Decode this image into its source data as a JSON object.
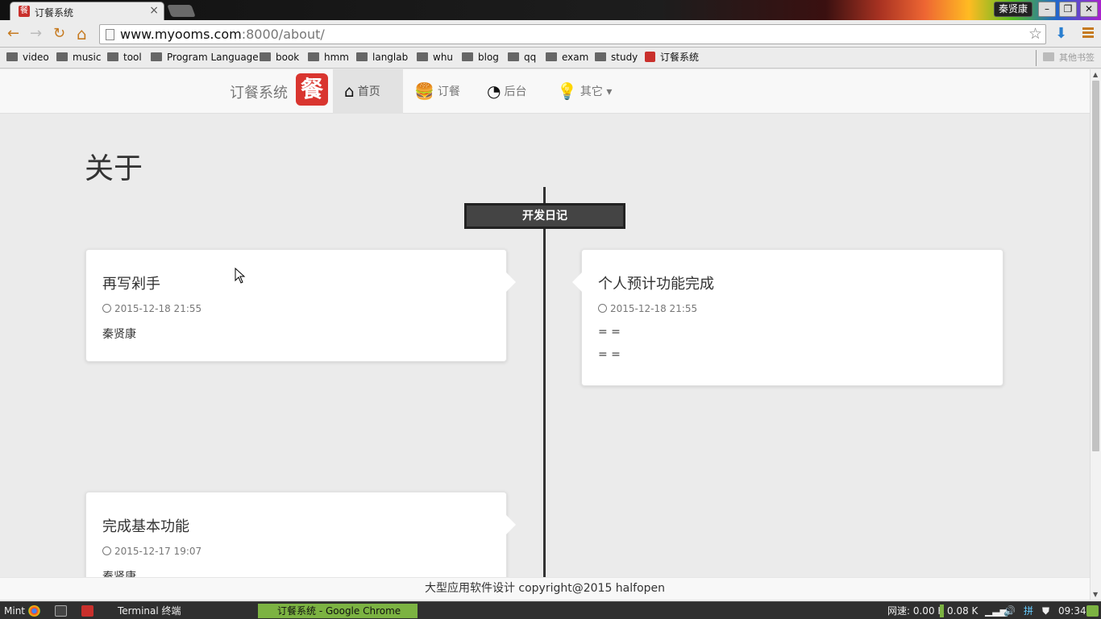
{
  "browser": {
    "tab_title": "订餐系统",
    "tab_close": "×",
    "user": "秦贤康",
    "win_min": "–",
    "win_max": "❐",
    "win_close": "✕",
    "url_host": "www.myooms.com",
    "url_path": ":8000/about/",
    "nav_back": "←",
    "nav_forward": "→",
    "nav_reload": "↻",
    "nav_home": "⌂",
    "star": "☆",
    "download": "⬇",
    "bookmarks": [
      "video",
      "music",
      "tool",
      "Program Language",
      "book",
      "hmm",
      "langlab",
      "whu",
      "blog",
      "qq",
      "exam",
      "study"
    ],
    "bookmark_app": "订餐系统",
    "other_bookmarks": "其他书签"
  },
  "site": {
    "brand": "订餐系统",
    "logo_char": "餐",
    "nav": [
      {
        "label": "首页",
        "icon": "⌂"
      },
      {
        "label": "订餐",
        "icon": "🍔"
      },
      {
        "label": "后台",
        "icon": "◔"
      },
      {
        "label": "其它 ▾",
        "icon": "💡"
      }
    ],
    "heading": "关于",
    "timeline_badge": "开发日记",
    "entries": [
      {
        "title": "再写剁手",
        "time": "2015-12-18 21:55",
        "lines": [
          "秦贤康"
        ]
      },
      {
        "title": "个人预计功能完成",
        "time": "2015-12-18 21:55",
        "lines": [
          "= =",
          "= ="
        ]
      },
      {
        "title": "完成基本功能",
        "time": "2015-12-17 19:07",
        "lines": [
          "秦贤康"
        ]
      }
    ],
    "footer": "大型应用软件设计 copyright@2015 halfopen"
  },
  "taskbar": {
    "menu": "Mint",
    "tasks": [
      "Terminal 终端",
      "订餐系统 - Google Chrome"
    ],
    "net_label": "网速: 0.00 K",
    "net_up": "0.08 K",
    "ime": "拼",
    "clock": "09:34"
  }
}
